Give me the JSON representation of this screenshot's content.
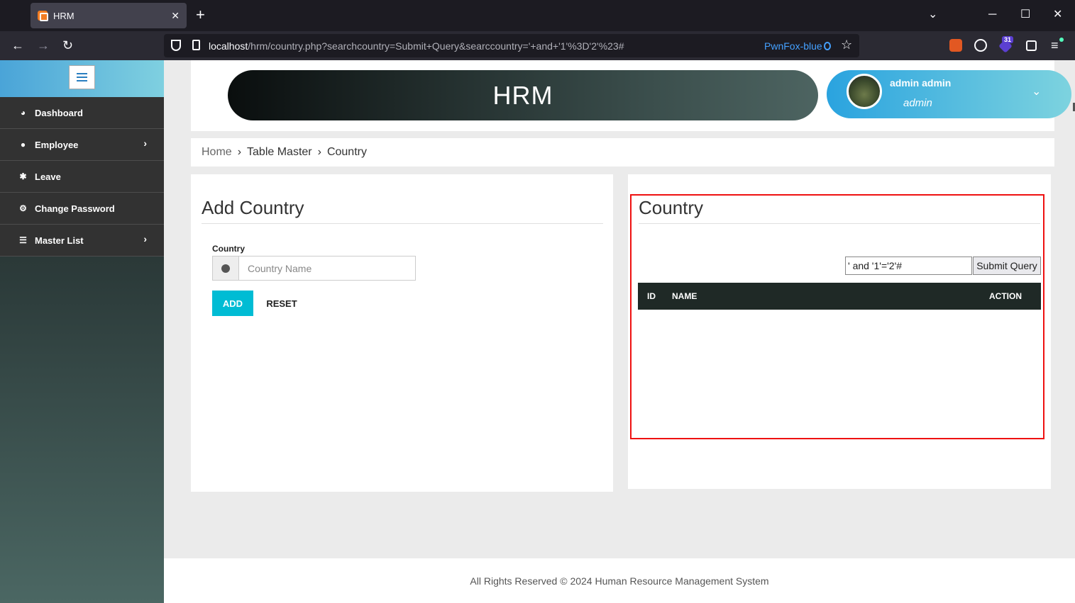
{
  "browser": {
    "tab_title": "HRM",
    "tab_close": "✕",
    "new_tab": "+",
    "url_host": "localhost",
    "url_path": "/hrm/country.php?searchcountry=Submit+Query&searccountry='+and+'1'%3D'2'%23#",
    "container_label": "PwnFox-blue",
    "extension_badge": "31",
    "colors": {
      "accent": "#45a1ff"
    }
  },
  "sidebar": {
    "items": [
      {
        "label": "Dashboard",
        "icon": "dashboard-icon",
        "has_chevron": false
      },
      {
        "label": "Employee",
        "icon": "user-icon",
        "has_chevron": true
      },
      {
        "label": "Leave",
        "icon": "leave-icon",
        "has_chevron": false
      },
      {
        "label": "Change Password",
        "icon": "cogs-icon",
        "has_chevron": false
      },
      {
        "label": "Master List",
        "icon": "list-icon",
        "has_chevron": true
      }
    ]
  },
  "header": {
    "app_title": "HRM",
    "user_name": "admin admin",
    "user_role": "admin"
  },
  "breadcrumb": {
    "items": [
      "Home",
      "Table Master",
      "Country"
    ]
  },
  "add_country": {
    "title": "Add Country",
    "field_label": "Country",
    "placeholder": "Country Name",
    "value": "",
    "add_label": "ADD",
    "reset_label": "RESET",
    "colors": {
      "add_button": "#00bcd4"
    }
  },
  "country_list": {
    "title": "Country",
    "search_value": "' and '1'='2'#",
    "submit_label": "Submit Query",
    "columns": [
      "ID",
      "NAME",
      "ACTION"
    ],
    "rows": []
  },
  "footer": {
    "text": "All Rights Reserved © 2024 Human Resource Management System"
  }
}
